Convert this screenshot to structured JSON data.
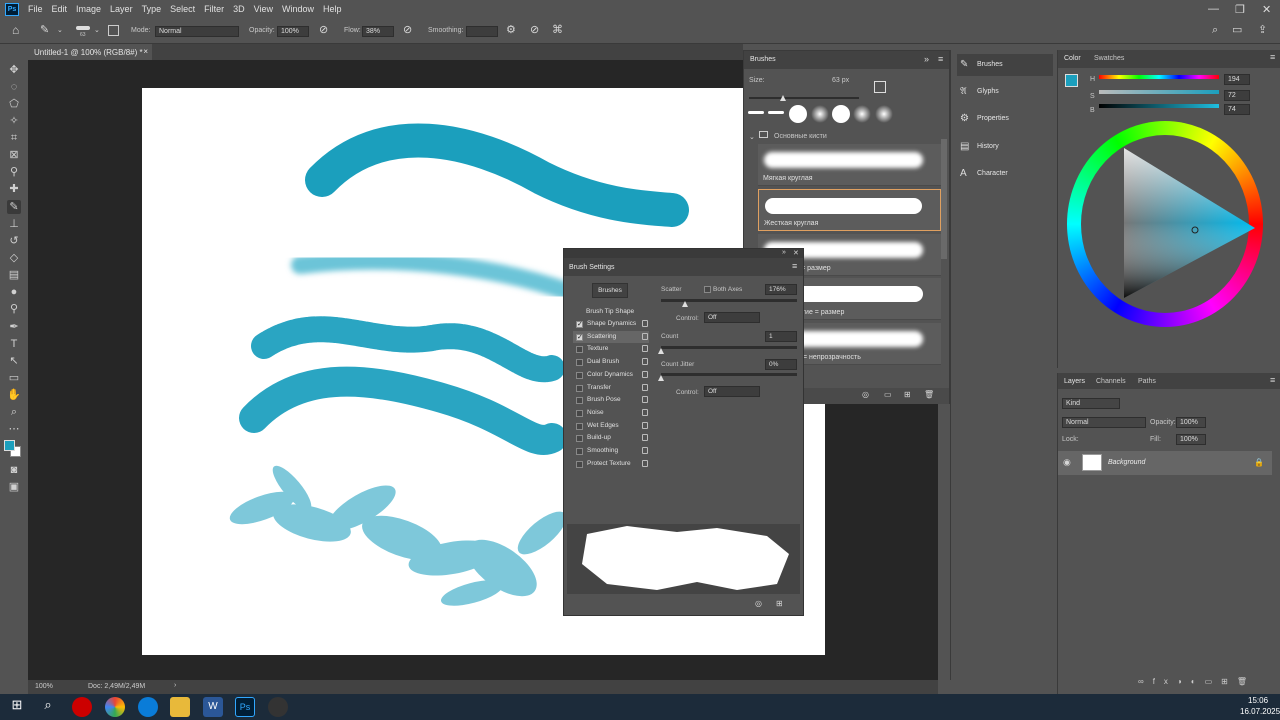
{
  "app": {
    "logo": "Ps"
  },
  "menu": [
    "File",
    "Edit",
    "Image",
    "Layer",
    "Type",
    "Select",
    "Filter",
    "3D",
    "View",
    "Window",
    "Help"
  ],
  "options": {
    "brush_size": "63",
    "mode_label": "Mode:",
    "mode_value": "Normal",
    "opacity_label": "Opacity:",
    "opacity_value": "100%",
    "flow_label": "Flow:",
    "flow_value": "38%",
    "smoothing_label": "Smoothing:",
    "smoothing_value": ""
  },
  "document": {
    "tab": "Untitled-1 @ 100% (RGB/8#) *",
    "close": "×"
  },
  "status": {
    "zoom": "100%",
    "doc": "Doc: 2,49M/2,49M",
    "arrow": "›"
  },
  "brushes_panel": {
    "title": "Brushes",
    "size_label": "Size:",
    "size_value": "63 px",
    "group": "Основные кисти",
    "presets": [
      "Мягкая круглая",
      "Жесткая круглая",
      "Мягкая круглая, нажатие = размер",
      "Жесткая круглая, нажатие = размер",
      "Мягкая круглая, нажатие = непрозрачность"
    ],
    "visible_names": [
      "Мягкая круглая",
      "Жесткая круглая",
      "… нажатие = размер",
      "…лая, нажатие = размер",
      "…, нажатие = непрозрачность"
    ]
  },
  "brush_settings": {
    "title": "Brush Settings",
    "brushes_button": "Brushes",
    "tip_shape": "Brush Tip Shape",
    "items": [
      {
        "label": "Shape Dynamics",
        "checked": true
      },
      {
        "label": "Scattering",
        "checked": true
      },
      {
        "label": "Texture",
        "checked": false
      },
      {
        "label": "Dual Brush",
        "checked": false
      },
      {
        "label": "Color Dynamics",
        "checked": false
      },
      {
        "label": "Transfer",
        "checked": false
      },
      {
        "label": "Brush Pose",
        "checked": false
      },
      {
        "label": "Noise",
        "checked": false
      },
      {
        "label": "Wet Edges",
        "checked": false
      },
      {
        "label": "Build-up",
        "checked": false
      },
      {
        "label": "Smoothing",
        "checked": false
      },
      {
        "label": "Protect Texture",
        "checked": false
      }
    ],
    "scatter_label": "Scatter",
    "both_axes": "Both Axes",
    "scatter_value": "176%",
    "control_label": "Control:",
    "control_value": "Off",
    "count_label": "Count",
    "count_value": "1",
    "count_jitter_label": "Count Jitter",
    "count_jitter_value": "0%",
    "control2_value": "Off",
    "scatter_level": 0.18,
    "count_level": 0.0,
    "jitter_level": 0.0
  },
  "side_panels": [
    "Brushes",
    "Glyphs",
    "Properties",
    "History",
    "Character"
  ],
  "color_panel": {
    "tab_color": "Color",
    "tab_swatches": "Swatches",
    "h_label": "H",
    "s_label": "S",
    "b_label": "B",
    "h_value": "194",
    "s_value": "72",
    "b_value": "74",
    "fg_color": "#1b9fbd"
  },
  "layers_panel": {
    "tabs": [
      "Layers",
      "Channels",
      "Paths"
    ],
    "kind": "Kind",
    "blend": "Normal",
    "opacity_label": "Opacity:",
    "opacity_value": "100%",
    "lock_label": "Lock:",
    "fill_label": "Fill:",
    "fill_value": "100%",
    "layer_name": "Background"
  },
  "taskbar": {
    "time": "15:06",
    "date": "16.07.2025"
  },
  "colors": {
    "stroke": "#1b9fbd",
    "panel": "#535353",
    "dark": "#262626"
  }
}
